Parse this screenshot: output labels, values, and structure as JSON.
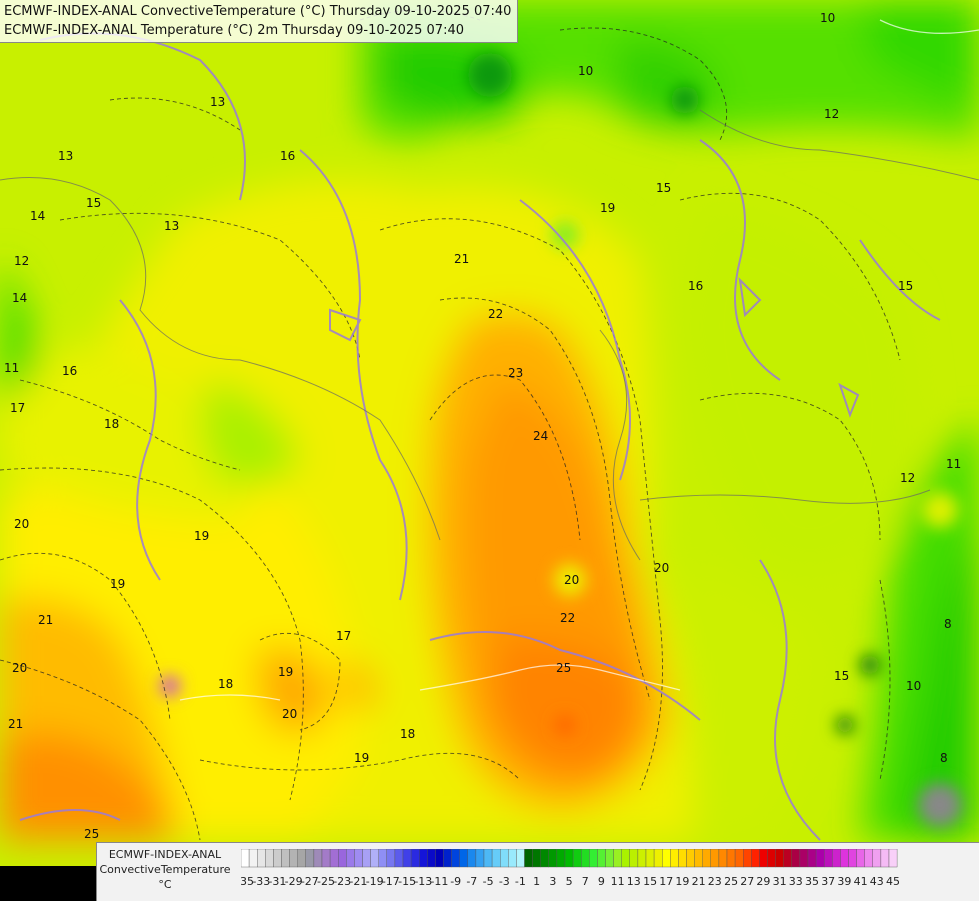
{
  "header": {
    "line1": "ECMWF-INDEX-ANAL ConvectiveTemperature (°C) Thursday 09-10-2025 07:40",
    "line2": "ECMWF-INDEX-ANAL Temperature (°C) 2m Thursday 09-10-2025 07:40"
  },
  "legend": {
    "title_line1": "ECMWF-INDEX-ANAL",
    "title_line2": "ConvectiveTemperature",
    "unit": "°C",
    "scale": [
      {
        "label": "-35",
        "color": "#ffffff"
      },
      {
        "label": "",
        "color": "#f2f2f2"
      },
      {
        "label": "-33",
        "color": "#e6e6e6"
      },
      {
        "label": "",
        "color": "#d9d9d9"
      },
      {
        "label": "-31",
        "color": "#cccccc"
      },
      {
        "label": "",
        "color": "#bfbfbf"
      },
      {
        "label": "-29",
        "color": "#b3b3b3"
      },
      {
        "label": "",
        "color": "#a6a6a6"
      },
      {
        "label": "-27",
        "color": "#9999a8"
      },
      {
        "label": "",
        "color": "#9e8ab8"
      },
      {
        "label": "-25",
        "color": "#a37bc8"
      },
      {
        "label": "",
        "color": "#a26ed4"
      },
      {
        "label": "-23",
        "color": "#9966dd"
      },
      {
        "label": "",
        "color": "#9a7aea"
      },
      {
        "label": "-21",
        "color": "#9f8cf2"
      },
      {
        "label": "",
        "color": "#a8a0f5"
      },
      {
        "label": "-19",
        "color": "#b0b0f8"
      },
      {
        "label": "",
        "color": "#8f8ff5"
      },
      {
        "label": "-17",
        "color": "#7777f0"
      },
      {
        "label": "",
        "color": "#5c5cec"
      },
      {
        "label": "-15",
        "color": "#4040e8"
      },
      {
        "label": "",
        "color": "#2a2ae0"
      },
      {
        "label": "-13",
        "color": "#1414d8"
      },
      {
        "label": "",
        "color": "#0a0ac8"
      },
      {
        "label": "-11",
        "color": "#0000b8"
      },
      {
        "label": "",
        "color": "#0022cc"
      },
      {
        "label": "-9",
        "color": "#0044dd"
      },
      {
        "label": "",
        "color": "#0066e8"
      },
      {
        "label": "-7",
        "color": "#1a88ee"
      },
      {
        "label": "",
        "color": "#33a0f2"
      },
      {
        "label": "-5",
        "color": "#4db8f5"
      },
      {
        "label": "",
        "color": "#66ccf8"
      },
      {
        "label": "-3",
        "color": "#80ddfa"
      },
      {
        "label": "",
        "color": "#99eafc"
      },
      {
        "label": "-1",
        "color": "#b3f5fd"
      },
      {
        "label": "",
        "color": "#006600"
      },
      {
        "label": "1",
        "color": "#007700"
      },
      {
        "label": "",
        "color": "#008800"
      },
      {
        "label": "3",
        "color": "#009900"
      },
      {
        "label": "",
        "color": "#00aa00"
      },
      {
        "label": "5",
        "color": "#00bb00"
      },
      {
        "label": "",
        "color": "#11cc11"
      },
      {
        "label": "7",
        "color": "#22dd22"
      },
      {
        "label": "",
        "color": "#33ee33"
      },
      {
        "label": "9",
        "color": "#55f033"
      },
      {
        "label": "",
        "color": "#77f033"
      },
      {
        "label": "11",
        "color": "#99f022"
      },
      {
        "label": "",
        "color": "#aaf200"
      },
      {
        "label": "13",
        "color": "#bbf000"
      },
      {
        "label": "",
        "color": "#ccf000"
      },
      {
        "label": "15",
        "color": "#ddf000"
      },
      {
        "label": "",
        "color": "#eef000"
      },
      {
        "label": "17",
        "color": "#ffff00"
      },
      {
        "label": "",
        "color": "#ffee00"
      },
      {
        "label": "19",
        "color": "#ffdd00"
      },
      {
        "label": "",
        "color": "#ffcc00"
      },
      {
        "label": "21",
        "color": "#ffbb00"
      },
      {
        "label": "",
        "color": "#ffaa00"
      },
      {
        "label": "23",
        "color": "#ff9900"
      },
      {
        "label": "",
        "color": "#ff8800"
      },
      {
        "label": "25",
        "color": "#ff7700"
      },
      {
        "label": "",
        "color": "#ff6600"
      },
      {
        "label": "27",
        "color": "#ff4400"
      },
      {
        "label": "",
        "color": "#ff2200"
      },
      {
        "label": "29",
        "color": "#ee0000"
      },
      {
        "label": "",
        "color": "#dd0000"
      },
      {
        "label": "31",
        "color": "#cc0000"
      },
      {
        "label": "",
        "color": "#bb0022"
      },
      {
        "label": "33",
        "color": "#aa0044"
      },
      {
        "label": "",
        "color": "#aa0066"
      },
      {
        "label": "35",
        "color": "#aa0088"
      },
      {
        "label": "",
        "color": "#aa00aa"
      },
      {
        "label": "37",
        "color": "#bb11bb"
      },
      {
        "label": "",
        "color": "#cc22cc"
      },
      {
        "label": "39",
        "color": "#dd33dd"
      },
      {
        "label": "",
        "color": "#e044e0"
      },
      {
        "label": "41",
        "color": "#e866e8"
      },
      {
        "label": "",
        "color": "#ee88ee"
      },
      {
        "label": "43",
        "color": "#f0a0f0"
      },
      {
        "label": "",
        "color": "#f5bbf5"
      },
      {
        "label": "45",
        "color": "#f8d0f8"
      }
    ]
  },
  "map": {
    "contour_labels": [
      "10",
      "10",
      "13",
      "13",
      "15",
      "14",
      "12",
      "14",
      "11",
      "16",
      "17",
      "18",
      "20",
      "21",
      "20",
      "21",
      "19",
      "19",
      "18",
      "17",
      "21",
      "22",
      "23",
      "24",
      "20",
      "22",
      "25",
      "20",
      "19",
      "18",
      "19",
      "15",
      "16",
      "15",
      "12",
      "11",
      "10",
      "8",
      "8",
      "12",
      "13",
      "15",
      "19",
      "16",
      "25",
      "20"
    ]
  }
}
